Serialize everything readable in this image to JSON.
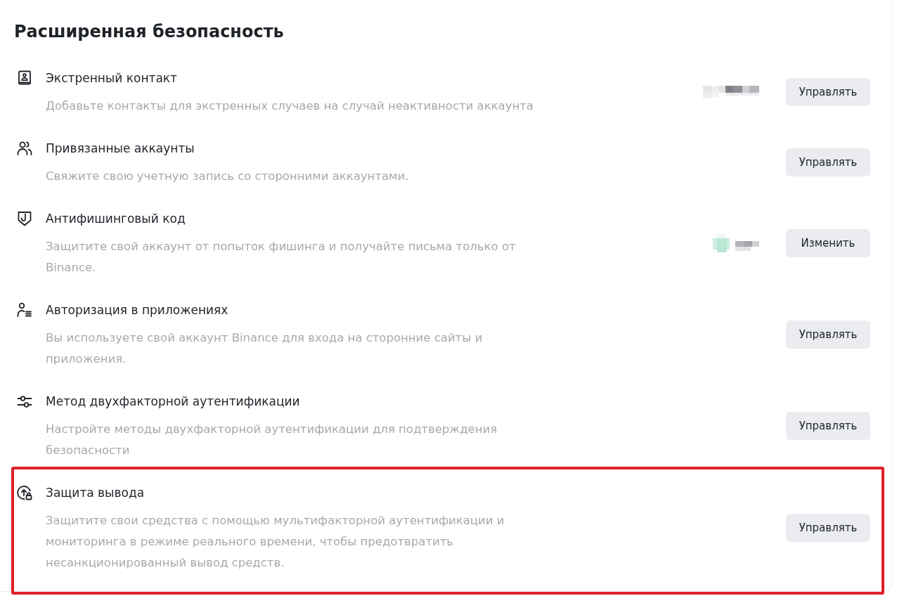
{
  "title": "Расширенная безопасность",
  "items": [
    {
      "title": "Экстренный контакт",
      "description": [
        "Добавьте контакты для экстренных случаев на случай неактивности аккаунта"
      ],
      "masked_value": true,
      "button": "Управлять",
      "highlighted": false
    },
    {
      "title": "Привязанные аккаунты",
      "description": [
        "Свяжите свою учетную запись со сторонними аккаунтами."
      ],
      "masked_value": false,
      "button": "Управлять",
      "highlighted": false
    },
    {
      "title": "Антифишинговый код",
      "description": [
        "Защитите свой аккаунт от попыток фишинга и получайте письма только от",
        "Binance."
      ],
      "masked_value": true,
      "button": "Изменить",
      "highlighted": false
    },
    {
      "title": "Авторизация в приложениях",
      "description": [
        "Вы используете свой аккаунт Binance для входа на сторонние сайты и",
        "приложения."
      ],
      "masked_value": false,
      "button": "Управлять",
      "highlighted": false
    },
    {
      "title": "Метод двухфакторной аутентификации",
      "description": [
        "Настройте методы двухфакторной аутентификации для подтверждения",
        "безопасности"
      ],
      "masked_value": false,
      "button": "Управлять",
      "highlighted": false
    },
    {
      "title": "Защита вывода",
      "description": [
        "Защитите свои средства с помощью мультифакторной аутентификации и",
        "мониторинга в режиме реального времени, чтобы предотвратить",
        "несанкционированный вывод средств."
      ],
      "masked_value": false,
      "button": "Управлять",
      "highlighted": true
    }
  ]
}
